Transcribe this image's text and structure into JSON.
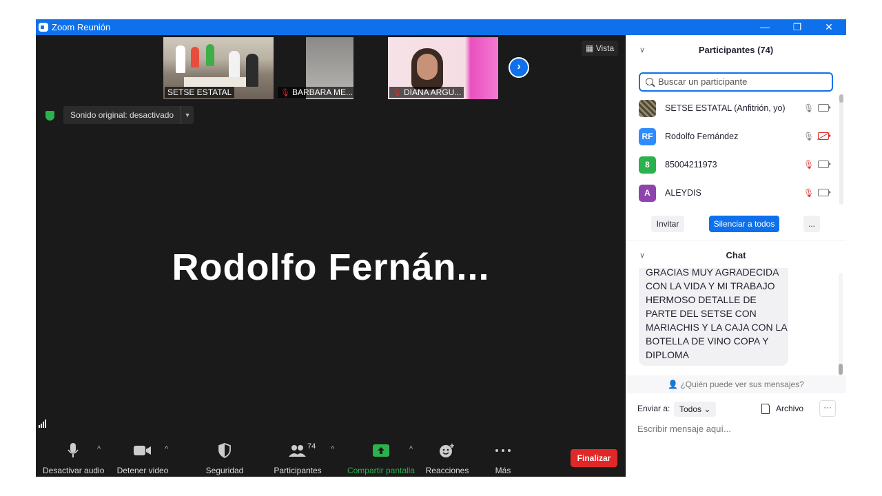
{
  "window": {
    "title": "Zoom Reunión",
    "min": "—",
    "restore": "❐",
    "close": "✕"
  },
  "video": {
    "thumbnails": [
      {
        "label": "SETSE ESTATAL",
        "muted": false
      },
      {
        "label": "BARBARA ME...",
        "muted": true
      },
      {
        "label": "DIANA ARGU...",
        "muted": true
      }
    ],
    "next_icon": "›",
    "view_label": "Vista",
    "sound_original": "Sonido original: desactivado",
    "sound_dropdown": "▼",
    "speaker_name": "Rodolfo  Fernán..."
  },
  "toolbar": {
    "mute": "Desactivar audio",
    "video": "Detener video",
    "security": "Seguridad",
    "participants": "Participantes",
    "participants_count": "74",
    "share": "Compartir pantalla",
    "reactions": "Reacciones",
    "more": "Más",
    "end": "Finalizar",
    "caret": "^"
  },
  "participants_panel": {
    "chevron": "∨",
    "title": "Participantes (74)",
    "search_placeholder": "Buscar un participante",
    "list": [
      {
        "initials": "",
        "name": "SETSE ESTATAL (Anfitrión, yo)",
        "avatar_color": "",
        "mic_muted": false,
        "cam_off": false
      },
      {
        "initials": "RF",
        "name": "Rodolfo Fernández",
        "avatar_color": "#2d8cff",
        "mic_muted": false,
        "cam_off": true
      },
      {
        "initials": "8",
        "name": "85004211973",
        "avatar_color": "#2bb24c",
        "mic_muted": true,
        "cam_off": false
      },
      {
        "initials": "A",
        "name": "ALEYDIS",
        "avatar_color": "#8e44ad",
        "mic_muted": true,
        "cam_off": false
      }
    ],
    "invite": "Invitar",
    "mute_all": "Silenciar a todos",
    "more": "..."
  },
  "chat_panel": {
    "chevron": "∨",
    "title": "Chat",
    "message": "GRACIAS MUY AGRADECIDA CON LA VIDA Y MI TRABAJO HERMOSO DETALLE DE PARTE DEL SETSE CON MARIACHIS Y LA CAJA CON LA BOTELLA DE VINO COPA Y DIPLOMA",
    "who_can_see": "¿Quién puede ver sus mensajes?",
    "send_to_label": "Enviar a:",
    "send_to_value": "Todos",
    "send_to_caret": "⌄",
    "file": "Archivo",
    "more": "···",
    "input_placeholder": "Escribir mensaje aquí..."
  },
  "colors": {
    "accent": "#0e71eb",
    "danger": "#e02828",
    "share_green": "#2bb24c"
  }
}
